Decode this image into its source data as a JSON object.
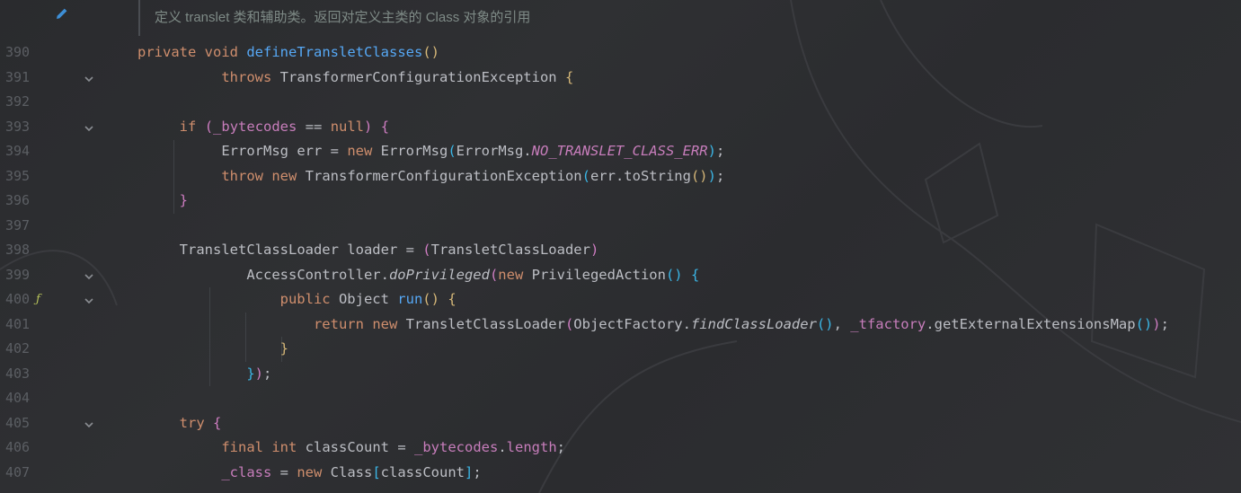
{
  "doc_comment": "定义 translet 类和辅助类。返回对定义主类的 Class 对象的引用",
  "icons": {
    "edit": "pencil-icon",
    "fold": "chevron-down-icon",
    "gutter": "lambda-icon"
  },
  "colors": {
    "keyword": "#cf8e6d",
    "function": "#56a8f5",
    "constant": "#c77dbb",
    "text": "#bcbec4",
    "line_number": "#5b5e63",
    "comment": "#7e8a86"
  },
  "lines": [
    {
      "n": "390",
      "fold": false,
      "gutter": "",
      "indent": "",
      "tokens": [
        {
          "t": "private",
          "c": "kw"
        },
        {
          "t": " "
        },
        {
          "t": "void",
          "c": "kw"
        },
        {
          "t": " "
        },
        {
          "t": "defineTransletClasses",
          "c": "fn"
        },
        {
          "t": "()",
          "c": "p1"
        }
      ]
    },
    {
      "n": "391",
      "fold": true,
      "gutter": "",
      "indent": "          ",
      "tokens": [
        {
          "t": "throws",
          "c": "kw"
        },
        {
          "t": " TransformerConfigurationException "
        },
        {
          "t": "{",
          "c": "p1"
        }
      ]
    },
    {
      "n": "392",
      "fold": false,
      "gutter": "",
      "indent": "",
      "tokens": []
    },
    {
      "n": "393",
      "fold": true,
      "gutter": "",
      "indent": "     ",
      "tokens": [
        {
          "t": "if",
          "c": "kw"
        },
        {
          "t": " "
        },
        {
          "t": "(",
          "c": "p2"
        },
        {
          "t": "_bytecodes",
          "c": "field"
        },
        {
          "t": " == "
        },
        {
          "t": "null",
          "c": "kw"
        },
        {
          "t": ")",
          "c": "p2"
        },
        {
          "t": " "
        },
        {
          "t": "{",
          "c": "p2"
        }
      ]
    },
    {
      "n": "394",
      "fold": false,
      "gutter": "",
      "indent": "          ",
      "tokens": [
        {
          "t": "ErrorMsg err = "
        },
        {
          "t": "new",
          "c": "kw"
        },
        {
          "t": " ErrorMsg"
        },
        {
          "t": "(",
          "c": "p3"
        },
        {
          "t": "ErrorMsg."
        },
        {
          "t": "NO_TRANSLET_CLASS_ERR",
          "c": "const"
        },
        {
          "t": ")",
          "c": "p3"
        },
        {
          "t": ";"
        }
      ]
    },
    {
      "n": "395",
      "fold": false,
      "gutter": "",
      "indent": "          ",
      "tokens": [
        {
          "t": "throw",
          "c": "kw"
        },
        {
          "t": " "
        },
        {
          "t": "new",
          "c": "kw"
        },
        {
          "t": " TransformerConfigurationException"
        },
        {
          "t": "(",
          "c": "p3"
        },
        {
          "t": "err.toString"
        },
        {
          "t": "()",
          "c": "p1"
        },
        {
          "t": ")",
          "c": "p3"
        },
        {
          "t": ";"
        }
      ]
    },
    {
      "n": "396",
      "fold": false,
      "gutter": "",
      "indent": "     ",
      "tokens": [
        {
          "t": "}",
          "c": "p2"
        }
      ]
    },
    {
      "n": "397",
      "fold": false,
      "gutter": "",
      "indent": "",
      "tokens": []
    },
    {
      "n": "398",
      "fold": false,
      "gutter": "",
      "indent": "     ",
      "tokens": [
        {
          "t": "TransletClassLoader loader = "
        },
        {
          "t": "(",
          "c": "p2"
        },
        {
          "t": "TransletClassLoader"
        },
        {
          "t": ")",
          "c": "p2"
        }
      ]
    },
    {
      "n": "399",
      "fold": true,
      "gutter": "",
      "indent": "             ",
      "tokens": [
        {
          "t": "AccessController."
        },
        {
          "t": "doPrivileged",
          "c": "ital"
        },
        {
          "t": "(",
          "c": "p2"
        },
        {
          "t": "new",
          "c": "kw"
        },
        {
          "t": " PrivilegedAction"
        },
        {
          "t": "()",
          "c": "p3"
        },
        {
          "t": " "
        },
        {
          "t": "{",
          "c": "p3"
        }
      ]
    },
    {
      "n": "400",
      "fold": true,
      "gutter": "ƒ",
      "indent": "                 ",
      "tokens": [
        {
          "t": "public",
          "c": "kw"
        },
        {
          "t": " Object "
        },
        {
          "t": "run",
          "c": "fn"
        },
        {
          "t": "()",
          "c": "p1"
        },
        {
          "t": " "
        },
        {
          "t": "{",
          "c": "p1"
        }
      ]
    },
    {
      "n": "401",
      "fold": false,
      "gutter": "",
      "indent": "                     ",
      "tokens": [
        {
          "t": "return",
          "c": "kw"
        },
        {
          "t": " "
        },
        {
          "t": "new",
          "c": "kw"
        },
        {
          "t": " TransletClassLoader"
        },
        {
          "t": "(",
          "c": "p2"
        },
        {
          "t": "ObjectFactory."
        },
        {
          "t": "findClassLoader",
          "c": "ital"
        },
        {
          "t": "()",
          "c": "p3"
        },
        {
          "t": ", "
        },
        {
          "t": "_tfactory",
          "c": "field"
        },
        {
          "t": ".getExternalExtensionsMap"
        },
        {
          "t": "()",
          "c": "p3"
        },
        {
          "t": ")",
          "c": "p2"
        },
        {
          "t": ";"
        }
      ]
    },
    {
      "n": "402",
      "fold": false,
      "gutter": "",
      "indent": "                 ",
      "tokens": [
        {
          "t": "}",
          "c": "p1"
        }
      ]
    },
    {
      "n": "403",
      "fold": false,
      "gutter": "",
      "indent": "             ",
      "tokens": [
        {
          "t": "}",
          "c": "p3"
        },
        {
          "t": ")",
          "c": "p2"
        },
        {
          "t": ";"
        }
      ]
    },
    {
      "n": "404",
      "fold": false,
      "gutter": "",
      "indent": "",
      "tokens": []
    },
    {
      "n": "405",
      "fold": true,
      "gutter": "",
      "indent": "     ",
      "tokens": [
        {
          "t": "try",
          "c": "kw"
        },
        {
          "t": " "
        },
        {
          "t": "{",
          "c": "p2"
        }
      ]
    },
    {
      "n": "406",
      "fold": false,
      "gutter": "",
      "indent": "          ",
      "tokens": [
        {
          "t": "final",
          "c": "kw"
        },
        {
          "t": " "
        },
        {
          "t": "int",
          "c": "kw"
        },
        {
          "t": " classCount = "
        },
        {
          "t": "_bytecodes",
          "c": "field"
        },
        {
          "t": "."
        },
        {
          "t": "length",
          "c": "field"
        },
        {
          "t": ";"
        }
      ]
    },
    {
      "n": "407",
      "fold": false,
      "gutter": "",
      "indent": "          ",
      "tokens": [
        {
          "t": "_class",
          "c": "field"
        },
        {
          "t": " = "
        },
        {
          "t": "new",
          "c": "kw"
        },
        {
          "t": " Class"
        },
        {
          "t": "[",
          "c": "p3"
        },
        {
          "t": "classCount"
        },
        {
          "t": "]",
          "c": "p3"
        },
        {
          "t": ";"
        }
      ]
    }
  ]
}
